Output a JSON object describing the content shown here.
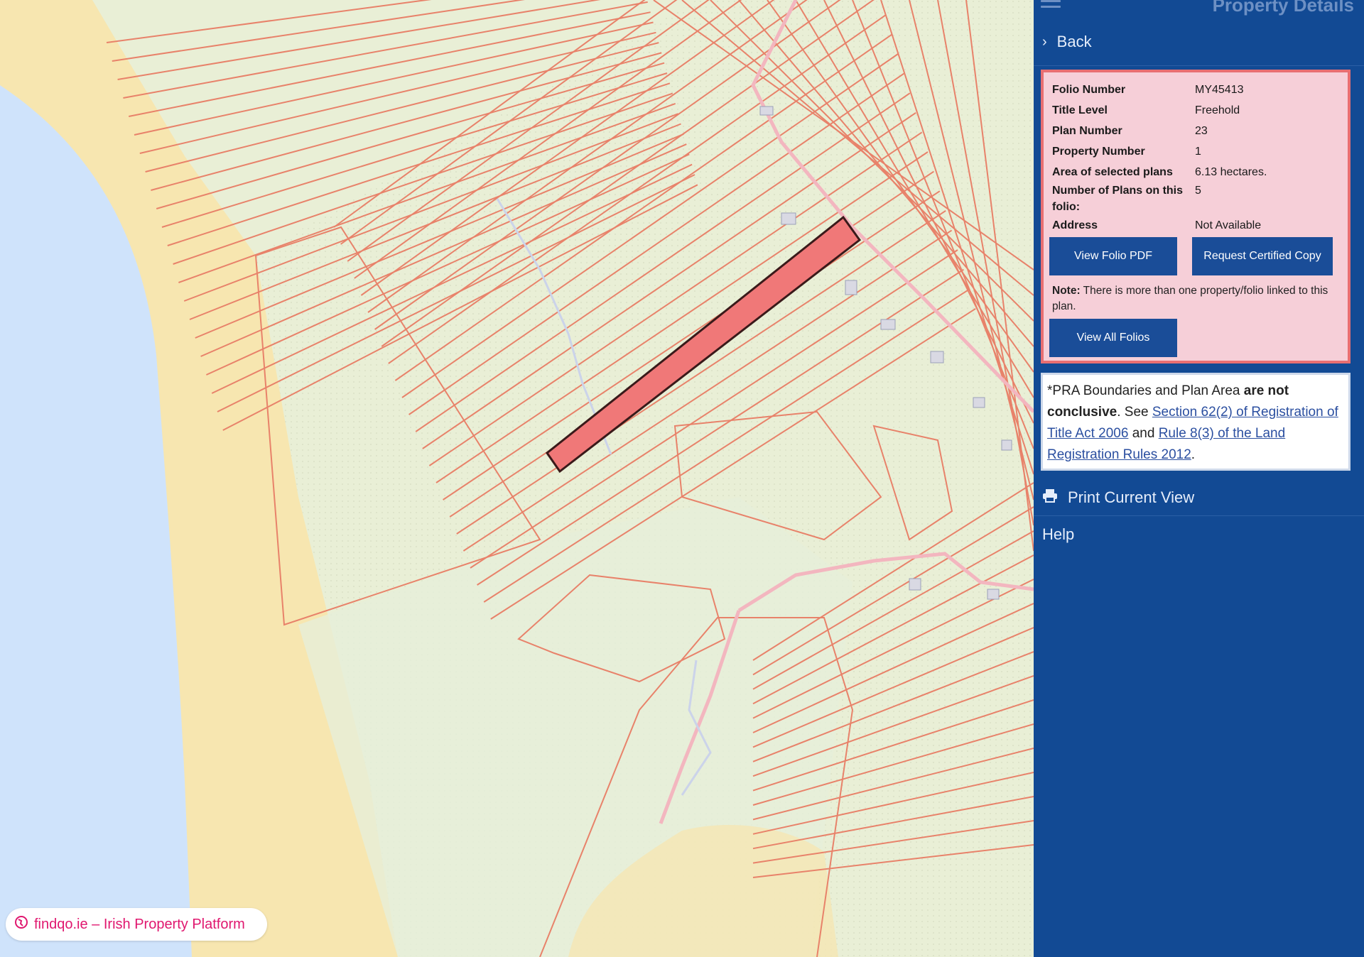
{
  "panel": {
    "title": "Property Details",
    "back_label": "Back",
    "details": [
      {
        "label": "Folio Number",
        "value": "MY45413"
      },
      {
        "label": "Title Level",
        "value": "Freehold"
      },
      {
        "label": "Plan Number",
        "value": "23"
      },
      {
        "label": "Property Number",
        "value": "1"
      },
      {
        "label": "Area of selected plans",
        "value": "6.13 hectares."
      },
      {
        "label": "Number of Plans on this folio:",
        "value": "5"
      },
      {
        "label": "Address",
        "value": "Not Available"
      }
    ],
    "view_folio_pdf_label": "View Folio PDF",
    "request_copy_label": "Request Certified Copy",
    "note_label": "Note:",
    "note_text": "There is more than one property/folio linked to this plan.",
    "view_all_folios_label": "View All Folios",
    "disclaimer": {
      "prefix": "*PRA Boundaries and Plan Area ",
      "bold": "are not conclusive",
      "see": ". See ",
      "link1": "Section 62(2) of Registration of Title Act 2006",
      "and": " and ",
      "link2": "Rule 8(3) of the Land Registration Rules 2012",
      "end": "."
    },
    "print_label": "Print Current View",
    "help_label": "Help"
  },
  "watermark": {
    "text": "findqo.ie – Irish Property Platform",
    "icon": "globe-icon"
  },
  "colors": {
    "panel_bg": "#124a94",
    "card_bg": "#f6cfd8",
    "card_border": "#e86f72",
    "selected_parcel": "#f07878",
    "boundary": "#e8826a",
    "sea": "#cfe3fb",
    "sand": "#f7e6b0",
    "land": "#e9efd6"
  }
}
